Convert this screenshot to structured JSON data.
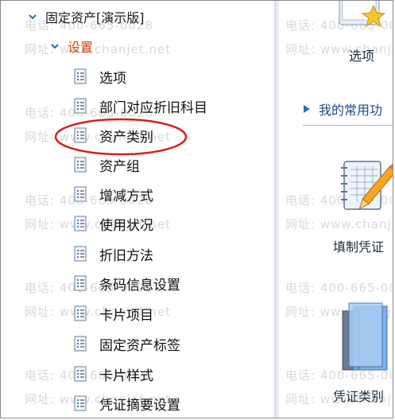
{
  "watermark": {
    "phone": "电话: 400-665-0028",
    "site": "网址: www.chanjet.net"
  },
  "tree": {
    "root_label": "固定资产[演示版]",
    "group_label": "设置",
    "items": [
      {
        "label": "选项"
      },
      {
        "label": "部门对应折旧科目"
      },
      {
        "label": "资产类别"
      },
      {
        "label": "资产组"
      },
      {
        "label": "增减方式"
      },
      {
        "label": "使用状况"
      },
      {
        "label": "折旧方法"
      },
      {
        "label": "条码信息设置"
      },
      {
        "label": "卡片项目"
      },
      {
        "label": "固定资产标签"
      },
      {
        "label": "卡片样式"
      },
      {
        "label": "凭证摘要设置"
      }
    ]
  },
  "right": {
    "options_label": "选项",
    "section_title": "我的常用功",
    "fill_voucher_label": "填制凭证",
    "voucher_type_label": "凭证类别"
  },
  "colors": {
    "accent": "#1d6fc2",
    "highlight_ellipse": "#d81e1e",
    "group_text": "#d0491a"
  },
  "icons": {
    "tree_caret": "chevron-down-icon",
    "tree_item": "document-list-icon",
    "section_marker": "triangle-right-icon",
    "options": "star-window-icon",
    "fill_voucher": "notebook-pencil-icon",
    "voucher_type": "books-icon"
  }
}
